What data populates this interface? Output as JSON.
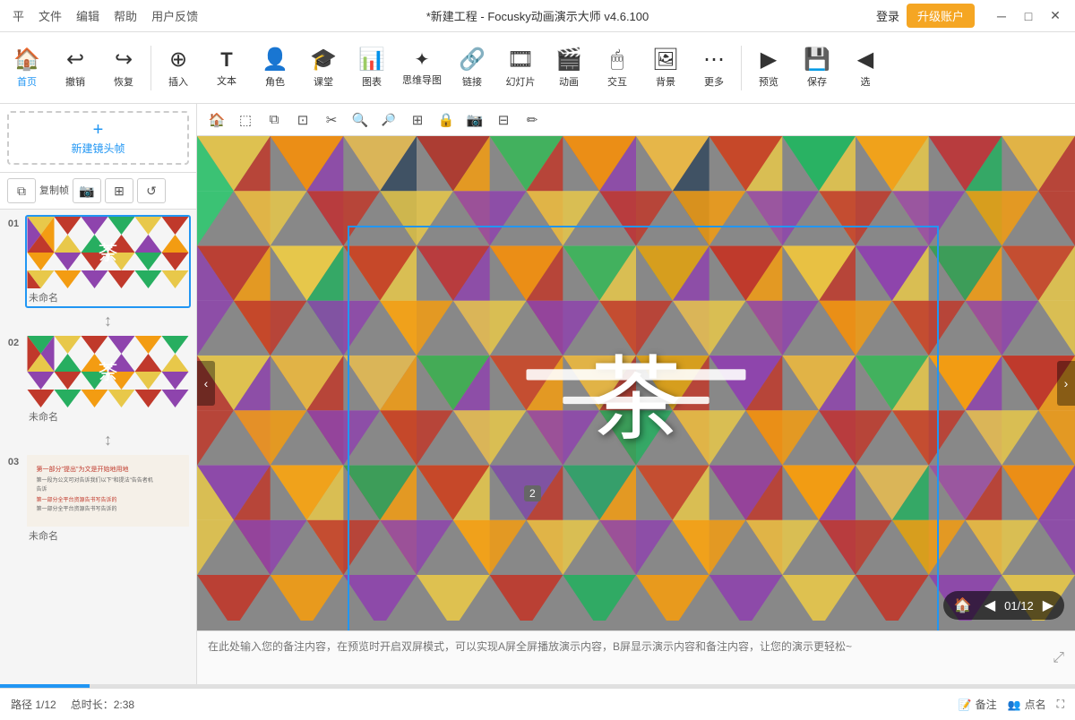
{
  "titleBar": {
    "title": "*新建工程 - Focusky动画演示大师  v4.6.100",
    "menuItems": [
      "平",
      "文件",
      "编辑",
      "帮助",
      "用户反馈"
    ],
    "loginLabel": "登录",
    "upgradeLabel": "升级账户",
    "minBtn": "─",
    "maxBtn": "□",
    "closeBtn": "✕"
  },
  "toolbar": {
    "items": [
      {
        "id": "home",
        "icon": "🏠",
        "label": "首页"
      },
      {
        "id": "undo",
        "icon": "↩",
        "label": "撤销"
      },
      {
        "id": "redo",
        "icon": "↪",
        "label": "恢复"
      },
      {
        "id": "insert",
        "icon": "⊕",
        "label": "插入"
      },
      {
        "id": "text",
        "icon": "T",
        "label": "文本"
      },
      {
        "id": "role",
        "icon": "👤",
        "label": "角色"
      },
      {
        "id": "class",
        "icon": "🎓",
        "label": "课堂"
      },
      {
        "id": "chart",
        "icon": "📊",
        "label": "图表"
      },
      {
        "id": "mindmap",
        "icon": "🔗",
        "label": "思维导图"
      },
      {
        "id": "link",
        "icon": "🔗",
        "label": "链接"
      },
      {
        "id": "slide",
        "icon": "🎞",
        "label": "幻灯片"
      },
      {
        "id": "animation",
        "icon": "🎬",
        "label": "动画"
      },
      {
        "id": "interact",
        "icon": "🖱",
        "label": "交互"
      },
      {
        "id": "bg",
        "icon": "🖼",
        "label": "背景"
      },
      {
        "id": "more",
        "icon": "⋯",
        "label": "更多"
      },
      {
        "id": "preview",
        "icon": "▶",
        "label": "预览"
      },
      {
        "id": "save",
        "icon": "💾",
        "label": "保存"
      },
      {
        "id": "nav",
        "icon": "◀",
        "label": "选"
      }
    ]
  },
  "sidebar": {
    "newFrameLabel": "新建镜头帧",
    "tools": [
      "复制帧",
      "📷",
      "⊞",
      "↺"
    ],
    "slides": [
      {
        "number": "01",
        "title": "未命名",
        "active": true
      },
      {
        "number": "02",
        "title": "未命名",
        "active": false
      },
      {
        "number": "03",
        "title": "未命名",
        "active": false
      }
    ]
  },
  "canvasTools": [
    "🏠",
    "⬚",
    "⬚",
    "⬚",
    "⬚",
    "🔍+",
    "🔍-",
    "⊞",
    "🔒",
    "📷",
    "⊡",
    "✏"
  ],
  "canvas": {
    "slideBadge": "2",
    "centerText": "茶"
  },
  "notes": {
    "placeholder": "在此处输入您的备注内容，在预览时开启双屏模式，可以实现A屏全屏播放演示内容，B屏显示演示内容和备注内容，让您的演示更轻松~",
    "expandIcon": "⤢"
  },
  "bottomBar": {
    "pathLabel": "路径 1/12",
    "totalLabel": "总时长：2:38",
    "noteBtn": "备注",
    "nameBtn": "点名"
  },
  "canvasNav": {
    "homeIcon": "🏠",
    "prevIcon": "◀",
    "progress": "01/12",
    "nextIcon": "▶"
  }
}
